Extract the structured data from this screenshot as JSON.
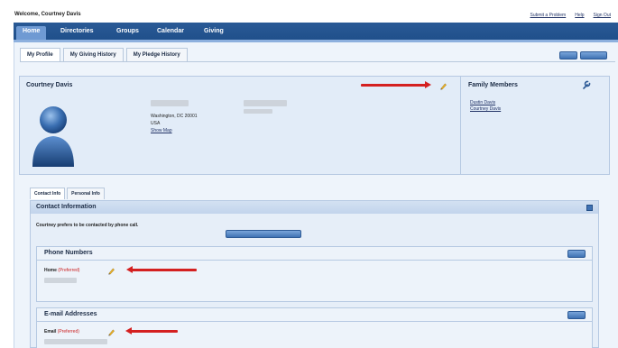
{
  "header": {
    "welcome": "Welcome, Courtney Davis",
    "links": [
      "Submit a Problem",
      "Help",
      "Sign Out"
    ]
  },
  "nav": {
    "items": [
      "Home",
      "Directories",
      "Groups",
      "Calendar",
      "Giving"
    ],
    "active": "Home"
  },
  "tabs": {
    "items": [
      "My Profile",
      "My Giving History",
      "My Pledge History"
    ],
    "active": "My Profile"
  },
  "profile": {
    "name": "Courtney Davis",
    "address_lines": [
      "Washington, DC 20001",
      "USA",
      "Show Map"
    ],
    "family_title": "Family Members",
    "family_members": [
      "Dustin Davis",
      "Courtney Davis"
    ]
  },
  "subtabs": {
    "items": [
      "Contact Info",
      "Personal Info"
    ],
    "active": "Contact Info"
  },
  "contact": {
    "title": "Contact Information",
    "preference_text": "Courtney prefers to be contacted by phone call.",
    "phone_title": "Phone Numbers",
    "phone_label": "Home",
    "phone_pref": "(Preferred)",
    "email_title": "E-mail Addresses",
    "email_label": "Email",
    "email_pref": "(Preferred)"
  },
  "colors": {
    "nav_bg": "#1f4f8a",
    "nav_active": "#6f9ad3",
    "panel_bg": "#eef4fb",
    "arrow_red": "#d42020",
    "preferred_red": "#cc2222"
  },
  "icons": [
    "pencil-icon",
    "wrench-icon",
    "collapse-icon",
    "avatar-silhouette"
  ]
}
